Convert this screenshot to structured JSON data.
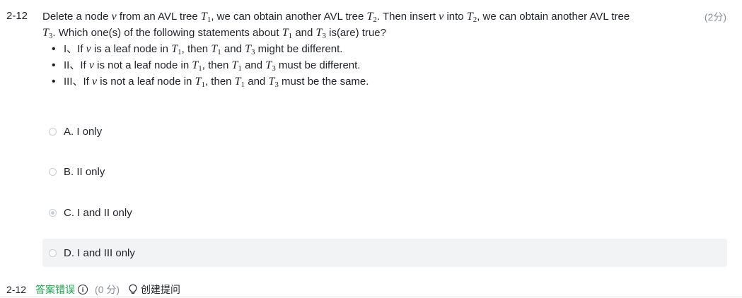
{
  "question": {
    "number": "2-12",
    "points": "(2分)",
    "stem": {
      "p1": "Delete a node ",
      "v1": "v",
      "p2": " from an AVL tree ",
      "t1": "T",
      "t1sub": "1",
      "p3": ", we can obtain another AVL tree ",
      "t2": "T",
      "t2sub": "2",
      "p4": ". Then insert ",
      "v2": "v",
      "p5": " into ",
      "t2b": "T",
      "t2bsub": "2",
      "p6": ", we can obtain another AVL tree ",
      "t3": "T",
      "t3sub": "3",
      "p7": ". Which one(s) of the following statements about ",
      "t1b": "T",
      "t1bsub": "1",
      "p8": " and ",
      "t3b": "T",
      "t3bsub": "3",
      "p9": " is(are) true?"
    },
    "statements": [
      {
        "prefix": "I、If ",
        "v": "v",
        "mid1": " is a leaf node in ",
        "tA": "T",
        "tAsub": "1",
        "mid2": ", then ",
        "tB": "T",
        "tBsub": "1",
        "mid3": " and ",
        "tC": "T",
        "tCsub": "3",
        "end": " might be different."
      },
      {
        "prefix": "II、If ",
        "v": "v",
        "mid1": " is not a leaf node in ",
        "tA": "T",
        "tAsub": "1",
        "mid2": ", then ",
        "tB": "T",
        "tBsub": "1",
        "mid3": " and ",
        "tC": "T",
        "tCsub": "3",
        "end": " must be different."
      },
      {
        "prefix": "III、If ",
        "v": "v",
        "mid1": " is not a leaf node in ",
        "tA": "T",
        "tAsub": "1",
        "mid2": ", then ",
        "tB": "T",
        "tBsub": "1",
        "mid3": " and ",
        "tC": "T",
        "tCsub": "3",
        "end": " must be the same."
      }
    ],
    "options": [
      {
        "label": "A.  I only",
        "selected": false
      },
      {
        "label": "B.  II only",
        "selected": false
      },
      {
        "label": "C.  I and II only",
        "selected": true
      },
      {
        "label": "D.  I and III only",
        "selected": false
      }
    ]
  },
  "footer": {
    "number": "2-12",
    "result": "答案错误",
    "info_icon_glyph": "i",
    "score": "(0 分)",
    "ask_label": "创建提问",
    "result_color": "#16a34a"
  }
}
